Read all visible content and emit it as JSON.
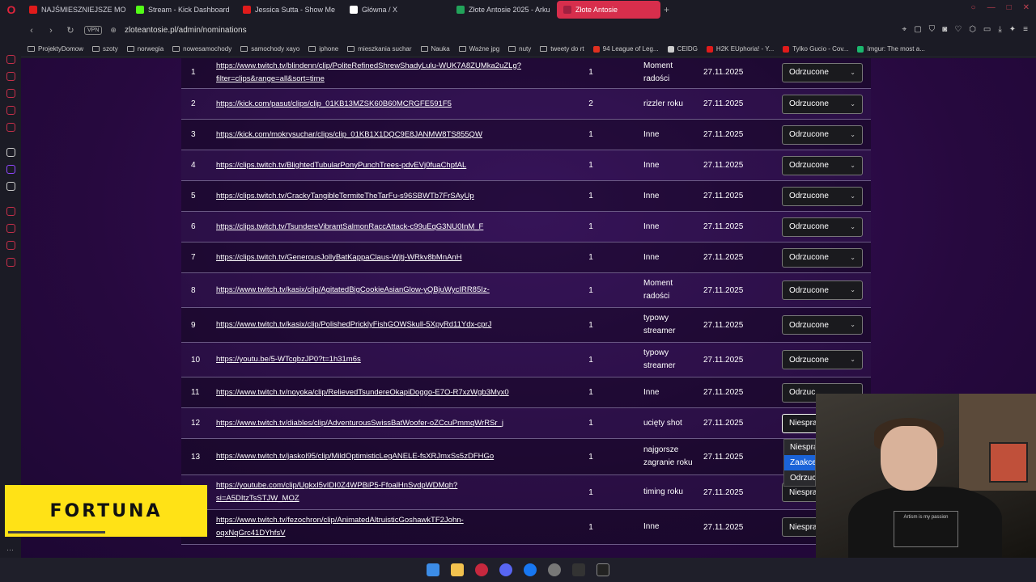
{
  "tabs": [
    {
      "label": "NAJŚMIESZNIEJSZE MOM",
      "color": "#e01b1b",
      "active": false
    },
    {
      "label": "Stream - Kick Dashboard",
      "color": "#53fc18",
      "active": false
    },
    {
      "label": "Jessica Sutta - Show Me",
      "color": "#e01b1b",
      "active": false
    },
    {
      "label": "Główna / X",
      "color": "#ffffff",
      "active": false
    },
    {
      "label": "Złote Antosie 2025 - Arku",
      "color": "#22a35a",
      "active": false
    },
    {
      "label": "Złote Antosie",
      "color": "#a02040",
      "active": true
    }
  ],
  "address": {
    "vpn": "VPN",
    "url": "zloteantosie.pl/admin/nominations"
  },
  "bookmarks": [
    {
      "label": "ProjektyDomow",
      "type": "folder"
    },
    {
      "label": "szoty",
      "type": "folder"
    },
    {
      "label": "norwegia",
      "type": "folder"
    },
    {
      "label": "nowesamochody",
      "type": "folder"
    },
    {
      "label": "samochody xayo",
      "type": "folder"
    },
    {
      "label": "iphone",
      "type": "folder"
    },
    {
      "label": "mieszkania suchar",
      "type": "folder"
    },
    {
      "label": "Nauka",
      "type": "folder"
    },
    {
      "label": "Ważne jpg",
      "type": "folder"
    },
    {
      "label": "nuty",
      "type": "folder"
    },
    {
      "label": "tweety do rt",
      "type": "folder"
    },
    {
      "label": "94 League of Leg...",
      "type": "site",
      "color": "#e03020"
    },
    {
      "label": "CEIDG",
      "type": "site",
      "color": "#cccccc"
    },
    {
      "label": "H2K EUphoria! - Y...",
      "type": "site",
      "color": "#e01b1b"
    },
    {
      "label": "Tylko Gucio - Cov...",
      "type": "site",
      "color": "#e01b1b"
    },
    {
      "label": "Imgur: The most a...",
      "type": "site",
      "color": "#1bb76e"
    }
  ],
  "rows": [
    {
      "num": "1",
      "link": [
        "https://www.twitch.tv/blindenn/clip/PoliteRefinedShrewShadyLulu-WUK7A8ZUMka2uZLg?",
        "filter=clips&range=all&sort=time"
      ],
      "votes": "1",
      "category": [
        "Moment",
        "radości"
      ],
      "date": "27.11.2025",
      "status": "Odrzucone"
    },
    {
      "num": "2",
      "link": [
        "https://kick.com/pasut/clips/clip_01KB13MZSK60B60MCRGFE591F5"
      ],
      "votes": "2",
      "category": [
        "rizzler roku"
      ],
      "date": "27.11.2025",
      "status": "Odrzucone"
    },
    {
      "num": "3",
      "link": [
        "https://kick.com/mokrysuchar/clips/clip_01KB1X1DQC9E8JANMW8TS855QW"
      ],
      "votes": "1",
      "category": [
        "Inne"
      ],
      "date": "27.11.2025",
      "status": "Odrzucone"
    },
    {
      "num": "4",
      "link": [
        "https://clips.twitch.tv/BlightedTubularPonyPunchTrees-pdvEVj0fuaChpfAL"
      ],
      "votes": "1",
      "category": [
        "Inne"
      ],
      "date": "27.11.2025",
      "status": "Odrzucone"
    },
    {
      "num": "5",
      "link": [
        "https://clips.twitch.tv/CrackyTangibleTermiteTheTarFu-s96SBWTb7FrSAyUp"
      ],
      "votes": "1",
      "category": [
        "Inne"
      ],
      "date": "27.11.2025",
      "status": "Odrzucone"
    },
    {
      "num": "6",
      "link": [
        "https://clips.twitch.tv/TsundereVibrantSalmonRaccAttack-c99uEqG3NU0InM_F"
      ],
      "votes": "1",
      "category": [
        "Inne"
      ],
      "date": "27.11.2025",
      "status": "Odrzucone"
    },
    {
      "num": "7",
      "link": [
        "https://clips.twitch.tv/GenerousJollyBatKappaClaus-Wjtj-WRkv8bMnAnH"
      ],
      "votes": "1",
      "category": [
        "Inne"
      ],
      "date": "27.11.2025",
      "status": "Odrzucone"
    },
    {
      "num": "8",
      "link": [
        "https://www.twitch.tv/kasix/clip/AgitatedBigCookieAsianGlow-yQBjuWycIRR85Iz-"
      ],
      "votes": "1",
      "category": [
        "Moment",
        "radości"
      ],
      "date": "27.11.2025",
      "status": "Odrzucone"
    },
    {
      "num": "9",
      "link": [
        "https://www.twitch.tv/kasix/clip/PolishedPricklyFishGOWSkull-5XpyRd11Ydx-cprJ"
      ],
      "votes": "1",
      "category": [
        "typowy",
        "streamer"
      ],
      "date": "27.11.2025",
      "status": "Odrzucone"
    },
    {
      "num": "10",
      "link": [
        "https://youtu.be/5-WTcqbzJP0?t=1h31m6s"
      ],
      "votes": "1",
      "category": [
        "typowy",
        "streamer"
      ],
      "date": "27.11.2025",
      "status": "Odrzucone"
    },
    {
      "num": "11",
      "link": [
        "https://www.twitch.tv/noyoka/clip/RelievedTsundereOkapiDoggo-E7O-R7xzWgb3Myx0"
      ],
      "votes": "1",
      "category": [
        "Inne"
      ],
      "date": "27.11.2025",
      "status": "Odrzuc"
    },
    {
      "num": "12",
      "link": [
        "https://www.twitch.tv/diables/clip/AdventurousSwissBatWoofer-oZCcuPmmqWrRSr_j"
      ],
      "votes": "1",
      "category": [
        "ucięty shot"
      ],
      "date": "27.11.2025",
      "status": "Niespra"
    },
    {
      "num": "13",
      "link": [
        "https://www.twitch.tv/jaskol95/clip/MildOptimisticLegANELE-fsXRJmxSs5zDFHGo"
      ],
      "votes": "1",
      "category": [
        "najgorsze",
        "zagranie roku"
      ],
      "date": "27.11.2025",
      "status": ""
    },
    {
      "num": "",
      "link": [
        "https://youtube.com/clip/UgkxI5vIDI0Z4WPBiP5-FfoalHnSvdpWDMqh?",
        "si=A5DItzTsSTJW_MOZ"
      ],
      "votes": "1",
      "category": [
        "timing roku"
      ],
      "date": "27.11.2025",
      "status": "Niespra"
    },
    {
      "num": "",
      "link": [
        "https://www.twitch.tv/fezochron/clip/AnimatedAltruisticGoshawkTF2John-",
        "oqxNqGrc41DYhfsV"
      ],
      "votes": "1",
      "category": [
        "Inne"
      ],
      "date": "27.11.2025",
      "status": "Niespra"
    }
  ],
  "dropdown": {
    "items": [
      "Niespra",
      "Zaakce",
      "Odrzuc"
    ],
    "highlighted": 1
  },
  "ad": {
    "brand": "FORTUNA"
  },
  "webcam": {
    "shirt_text": "Artism is my passion"
  }
}
